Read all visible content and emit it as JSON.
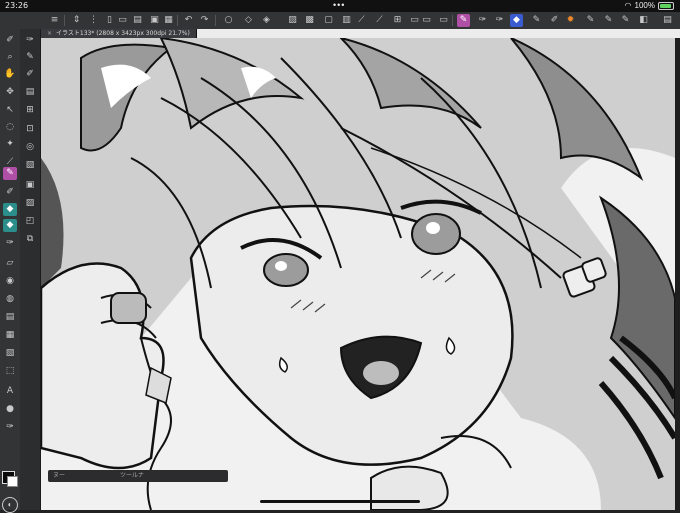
{
  "status_bar": {
    "time": "23:26",
    "dots": "•••",
    "battery": "100%"
  },
  "toolbar": {
    "buttons": [
      "menu-icon",
      "sort-icon",
      "undo-list-icon",
      "new-icon",
      "open-icon",
      "save-icon",
      "export-icon",
      "undo-icon",
      "redo-icon",
      "circle-icon",
      "rotate-icon",
      "transform-icon",
      "clear-icon",
      "fill-icon",
      "clip-icon",
      "ruler-icon",
      "ruler-snap-icon",
      "grid-icon",
      "layer-icon",
      "reference-icon",
      "pen-pressure-icon",
      "brush-icon",
      "sub-tool-icon",
      "airbrush-icon",
      "color-icon",
      "eyedropper-icon",
      "gradient-icon",
      "view-icon",
      "settings-icon"
    ]
  },
  "canvas_tab": {
    "close": "×",
    "title": "イラスト133* (2808 x 3423px 300dpi 21.7%)"
  },
  "bottom_popup": {
    "left_label": "ヌー",
    "right_label": "ツールナ"
  },
  "colors": {
    "accent": "#b04fa6",
    "toolbar_bg": "#333436",
    "canvas_bg": "#ececec"
  }
}
